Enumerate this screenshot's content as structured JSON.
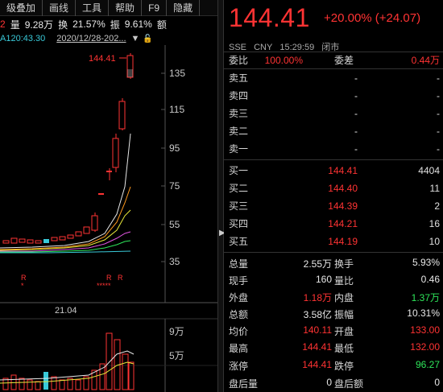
{
  "menu": [
    "级叠加",
    "画线",
    "工具",
    "帮助",
    "F9",
    "隐藏"
  ],
  "stats_bar": {
    "prefix": "2",
    "vol_label": "量",
    "vol_value": "9.28万",
    "turn_label": "换",
    "turn_value": "21.57%",
    "amp_label": "振",
    "amp_value": "9.61%",
    "amt_label": "额"
  },
  "ma_label": "A120:43.30",
  "date_range": "2020/12/28-202...",
  "chart": {
    "peak_label": "144.41",
    "y_ticks": [
      "135",
      "115",
      "95",
      "75",
      "55",
      "35"
    ],
    "x_tick": "21.04",
    "vol_ticks": [
      "9万",
      "5万"
    ],
    "r_marks": [
      "R",
      "R",
      "R"
    ]
  },
  "quote": {
    "price": "144.41",
    "change": "+20.00% (+24.07)",
    "exchange": "SSE",
    "currency": "CNY",
    "time": "15:29:59",
    "status": "闭市",
    "weibi_label": "委比",
    "weibi_value": "100.00%",
    "weicha_label": "委差",
    "weicha_value": "0.44万",
    "asks": [
      {
        "label": "卖五",
        "price": "-",
        "vol": "-"
      },
      {
        "label": "卖四",
        "price": "-",
        "vol": "-"
      },
      {
        "label": "卖三",
        "price": "-",
        "vol": "-"
      },
      {
        "label": "卖二",
        "price": "-",
        "vol": "-"
      },
      {
        "label": "卖一",
        "price": "-",
        "vol": "-"
      }
    ],
    "bids": [
      {
        "label": "买一",
        "price": "144.41",
        "vol": "4404"
      },
      {
        "label": "买二",
        "price": "144.40",
        "vol": "11"
      },
      {
        "label": "买三",
        "price": "144.39",
        "vol": "2"
      },
      {
        "label": "买四",
        "price": "144.21",
        "vol": "16"
      },
      {
        "label": "买五",
        "price": "144.19",
        "vol": "10"
      }
    ],
    "stats": [
      {
        "l1": "总量",
        "v1": "2.55万",
        "l2": "换手",
        "v2": "5.93%",
        "c1": "white",
        "c2": "white"
      },
      {
        "l1": "现手",
        "v1": "160",
        "l2": "量比",
        "v2": "0.46",
        "c1": "white",
        "c2": "white"
      },
      {
        "l1": "外盘",
        "v1": "1.18万",
        "l2": "内盘",
        "v2": "1.37万",
        "c1": "red",
        "c2": "green"
      },
      {
        "l1": "总额",
        "v1": "3.58亿",
        "l2": "振幅",
        "v2": "10.31%",
        "c1": "white",
        "c2": "white"
      },
      {
        "l1": "均价",
        "v1": "140.11",
        "l2": "开盘",
        "v2": "133.00",
        "c1": "red",
        "c2": "red"
      },
      {
        "l1": "最高",
        "v1": "144.41",
        "l2": "最低",
        "v2": "132.00",
        "c1": "red",
        "c2": "red"
      },
      {
        "l1": "涨停",
        "v1": "144.41",
        "l2": "跌停",
        "v2": "96.27",
        "c1": "red",
        "c2": "green"
      },
      {
        "l1": "盘后量",
        "v1": "0",
        "l2": "盘后额",
        "v2": "0",
        "c1": "white",
        "c2": "white"
      }
    ]
  }
}
